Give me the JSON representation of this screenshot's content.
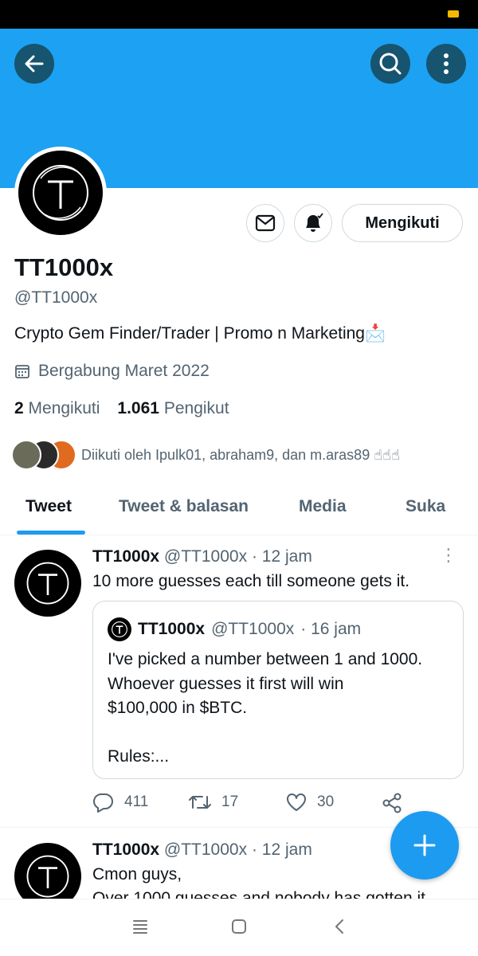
{
  "profile": {
    "name": "TT1000x",
    "handle": "@TT1000x",
    "bio": "Crypto Gem Finder/Trader | Promo n Marketing📩",
    "joined": "Bergabung Maret 2022",
    "following_count": "2",
    "following_label": "Mengikuti",
    "followers_count": "1.061",
    "followers_label": "Pengikut",
    "followed_by": "Diikuti oleh Ipulk01, abraham9, dan m.aras89 ☝☝☝",
    "follow_button": "Mengikuti"
  },
  "tabs": [
    {
      "label": "Tweet"
    },
    {
      "label": "Tweet & balasan"
    },
    {
      "label": "Media"
    },
    {
      "label": "Suka"
    }
  ],
  "tweets": [
    {
      "name": "TT1000x",
      "handle": "@TT1000x",
      "time": "· 12 jam",
      "text": "10 more guesses each till someone gets it.",
      "quote": {
        "name": "TT1000x",
        "handle": "@TT1000x",
        "time": "· 16 jam",
        "text": "I've picked a number between 1 and 1000.\nWhoever guesses it first will win\n$100,000 in $BTC.\n\nRules:..."
      },
      "replies": "411",
      "retweets": "17",
      "likes": "30"
    },
    {
      "name": "TT1000x",
      "handle": "@TT1000x",
      "time": "· 12 jam",
      "text": "Cmon guys,",
      "text2": "Over 1000 guesses and nobody has gotten it"
    }
  ],
  "colors": {
    "banner": "#1da1f2",
    "accent": "#1d9bf0"
  }
}
